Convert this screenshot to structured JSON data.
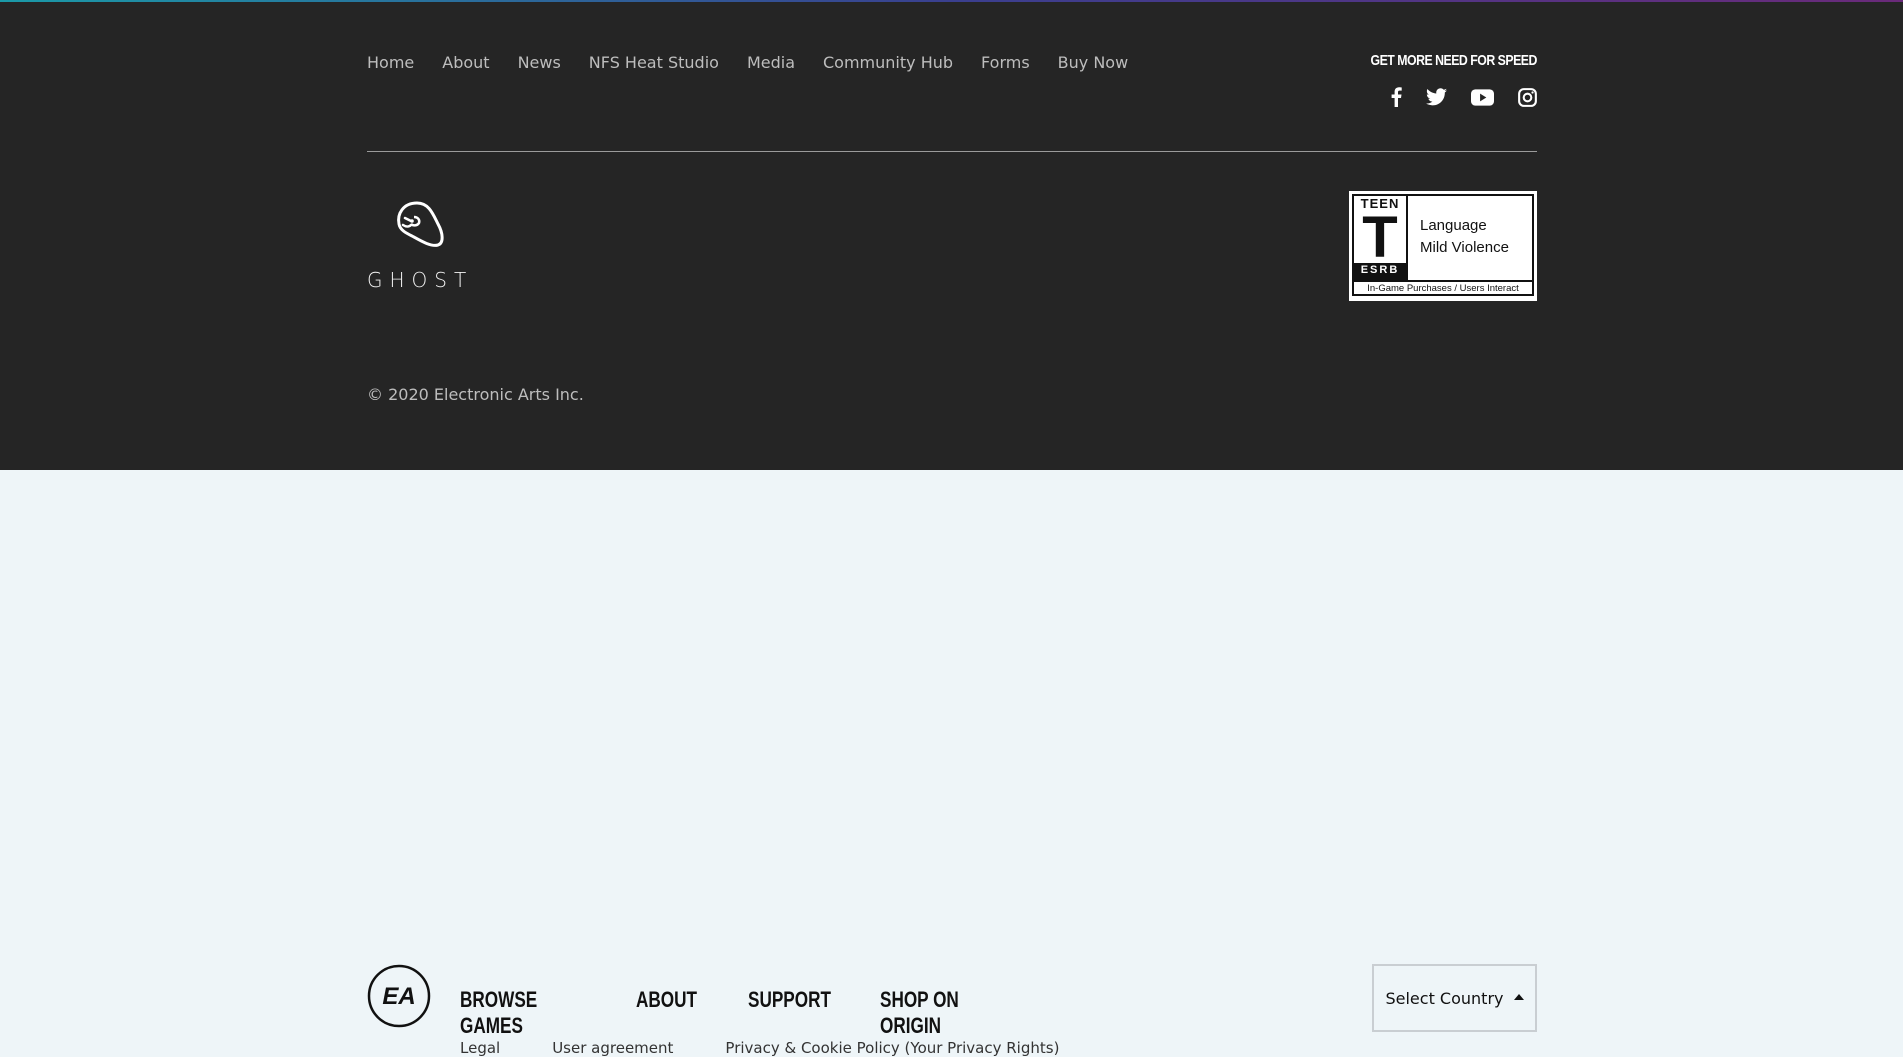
{
  "nav": {
    "items": [
      {
        "label": "Home"
      },
      {
        "label": "About"
      },
      {
        "label": "News"
      },
      {
        "label": "NFS Heat Studio"
      },
      {
        "label": "Media"
      },
      {
        "label": "Community Hub"
      },
      {
        "label": "Forms"
      },
      {
        "label": "Buy Now"
      }
    ]
  },
  "social": {
    "heading": "GET MORE NEED FOR SPEED",
    "icons": [
      "facebook-icon",
      "twitter-icon",
      "youtube-icon",
      "instagram-icon"
    ]
  },
  "brand": {
    "studio_name": "GHOST"
  },
  "esrb": {
    "rating": "T",
    "top_label": "TEEN",
    "bottom_label": "ESRB",
    "descriptor_1": "Language",
    "descriptor_2": "Mild Violence",
    "interactive": "In-Game Purchases / Users Interact"
  },
  "copyright": "© 2020 Electronic Arts Inc.",
  "ea_footer": {
    "logo_text": "EA",
    "links": [
      {
        "label": "BROWSE GAMES"
      },
      {
        "label": "ABOUT"
      },
      {
        "label": "SUPPORT"
      },
      {
        "label": "SHOP ON ORIGIN"
      }
    ],
    "sublinks": [
      {
        "label": "Legal"
      },
      {
        "label": "User agreement"
      },
      {
        "label": "Privacy & Cookie Policy (Your Privacy Rights)"
      }
    ],
    "country_select": "Select Country"
  }
}
